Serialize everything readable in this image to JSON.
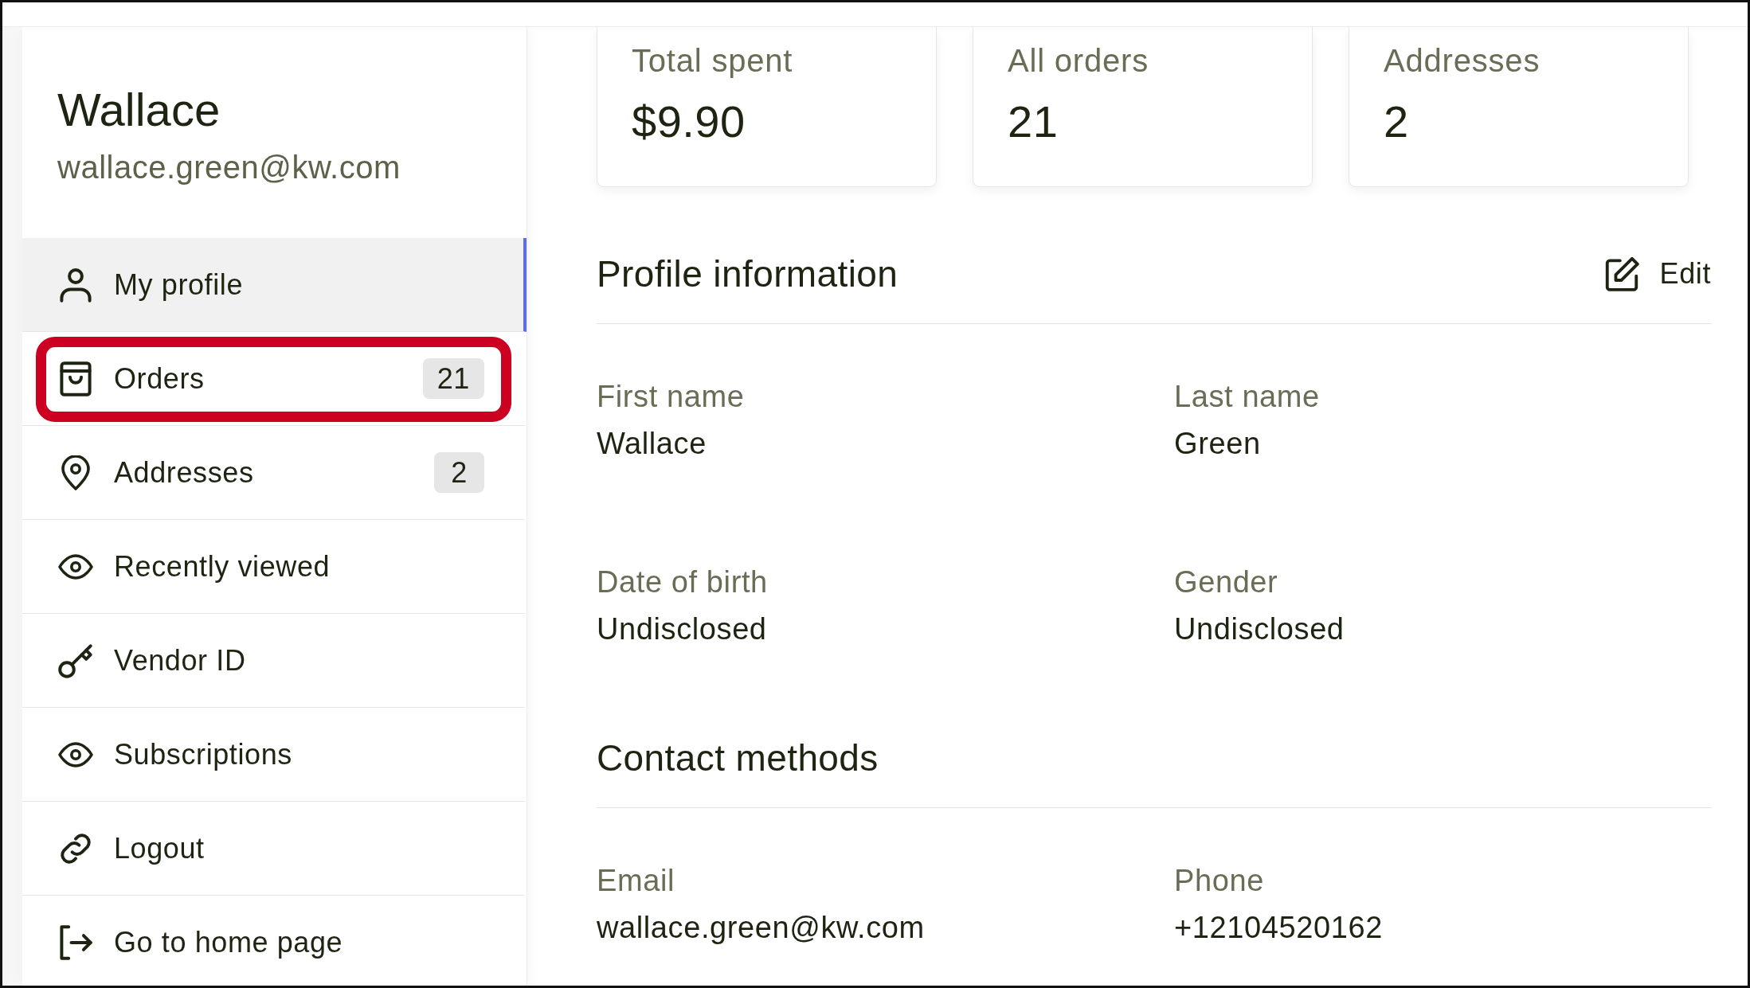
{
  "profile": {
    "name": "Wallace",
    "email": "wallace.green@kw.com"
  },
  "nav": [
    {
      "label": "My profile",
      "selected": true,
      "highlighted": false
    },
    {
      "label": "Orders",
      "count": "21",
      "selected": false,
      "highlighted": true
    },
    {
      "label": "Addresses",
      "count": "2",
      "selected": false,
      "highlighted": false
    },
    {
      "label": "Recently viewed",
      "selected": false,
      "highlighted": false
    },
    {
      "label": "Vendor ID",
      "selected": false,
      "highlighted": false
    },
    {
      "label": "Subscriptions",
      "selected": false,
      "highlighted": false
    },
    {
      "label": "Logout",
      "selected": false,
      "highlighted": false
    },
    {
      "label": "Go to home page",
      "selected": false,
      "highlighted": false
    }
  ],
  "stats": [
    {
      "label": "Total spent",
      "value": "$9.90"
    },
    {
      "label": "All orders",
      "value": "21"
    },
    {
      "label": "Addresses",
      "value": "2"
    }
  ],
  "profile_information": {
    "title": "Profile information",
    "edit_label": "Edit",
    "fields": [
      {
        "label": "First name",
        "value": "Wallace"
      },
      {
        "label": "Last name",
        "value": "Green"
      },
      {
        "label": "Date of birth",
        "value": "Undisclosed"
      },
      {
        "label": "Gender",
        "value": "Undisclosed"
      }
    ]
  },
  "contact_methods": {
    "title": "Contact methods",
    "fields": [
      {
        "label": "Email",
        "value": "wallace.green@kw.com"
      },
      {
        "label": "Phone",
        "value": "+12104520162"
      }
    ]
  }
}
